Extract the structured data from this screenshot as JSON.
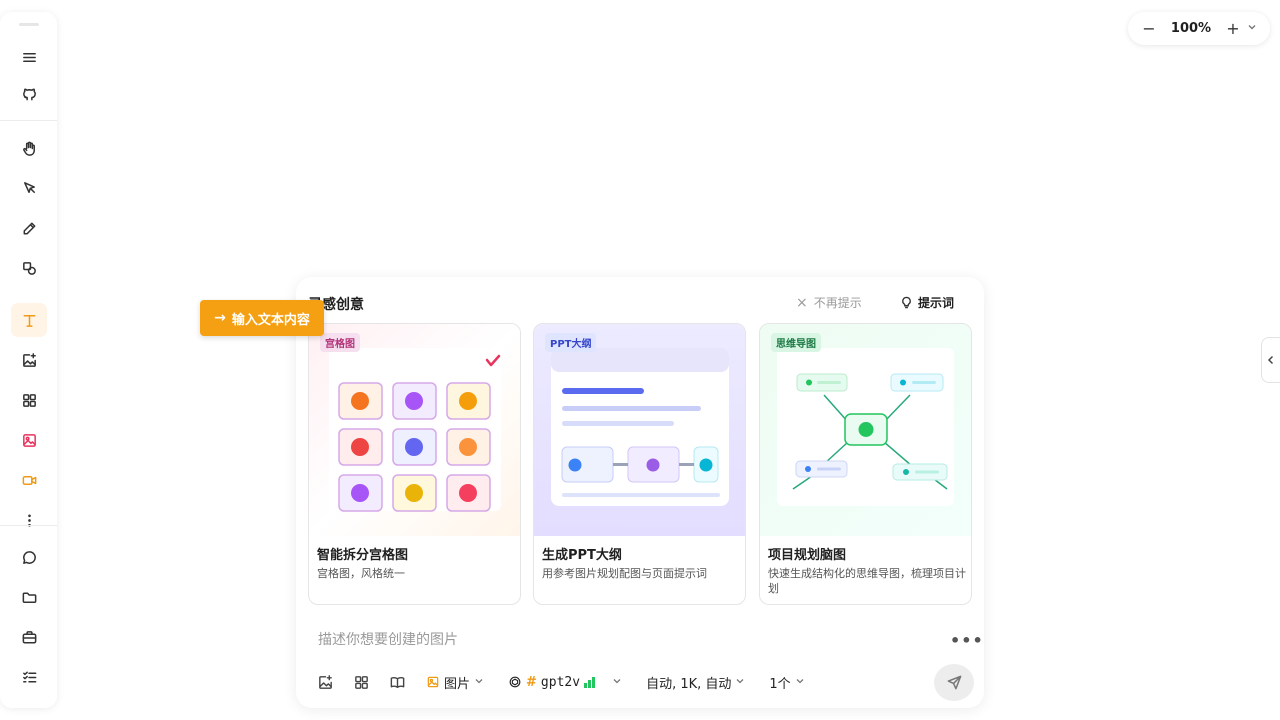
{
  "toolbar": {
    "items": [
      {
        "name": "menu",
        "icon": "menu-icon"
      },
      {
        "name": "github",
        "icon": "github-icon"
      },
      {
        "name": "hand",
        "icon": "hand-icon"
      },
      {
        "name": "select",
        "icon": "cursor-icon"
      },
      {
        "name": "pencil",
        "icon": "pencil-icon"
      },
      {
        "name": "shapes",
        "icon": "shapes-icon"
      },
      {
        "name": "text",
        "icon": "text-icon"
      },
      {
        "name": "ai-image",
        "icon": "image-sparkle-icon"
      },
      {
        "name": "grid",
        "icon": "grid-icon"
      },
      {
        "name": "image",
        "icon": "image-icon"
      },
      {
        "name": "video",
        "icon": "video-icon"
      },
      {
        "name": "more",
        "icon": "more-vertical-icon"
      },
      {
        "name": "chat",
        "icon": "chat-icon"
      },
      {
        "name": "folder",
        "icon": "folder-icon"
      },
      {
        "name": "briefcase",
        "icon": "briefcase-icon"
      },
      {
        "name": "tasks",
        "icon": "checklist-icon"
      }
    ],
    "active": "text",
    "accent": "#f09a16"
  },
  "zoom": {
    "minus": "−",
    "value": "100%",
    "plus": "+"
  },
  "tooltip": {
    "arrow": "→",
    "text": "输入文本内容"
  },
  "panel": {
    "title": "灵感创意",
    "dismiss": "不再提示",
    "dismiss_x": "×",
    "hint_label": "提示词",
    "cards": [
      {
        "badge": "宫格图",
        "title": "智能拆分宫格图",
        "desc": "宫格图，风格统一"
      },
      {
        "badge": "PPT大纲",
        "title": "生成PPT大纲",
        "desc": "用参考图片规划配图与页面提示词"
      },
      {
        "badge": "思维导图",
        "title": "项目规划脑图",
        "desc": "快速生成结构化的思维导图，梳理项目计划"
      }
    ],
    "prompt_placeholder": "描述你想要创建的图片",
    "more": "•••",
    "mode_label": "图片",
    "model_hash": "#",
    "model_label": "gpt2v",
    "params_label": "自动, 1K, 自动",
    "count_label": "1个"
  }
}
